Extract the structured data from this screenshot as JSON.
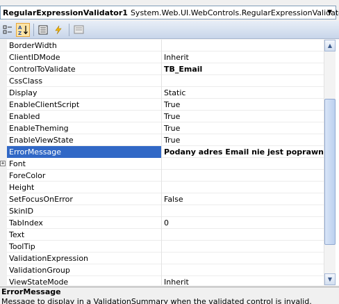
{
  "object_selector": {
    "name": "RegularExpressionValidator1",
    "type": "System.Web.UI.WebControls.RegularExpressionValidator"
  },
  "toolbar": {
    "buttons": [
      {
        "name": "categorized",
        "icon": "categorized-icon"
      },
      {
        "name": "alphabetical",
        "icon": "alphabetical-sort-icon",
        "active": true
      },
      {
        "name": "properties",
        "icon": "properties-icon"
      },
      {
        "name": "events",
        "icon": "lightning-icon"
      },
      {
        "name": "property-pages",
        "icon": "property-pages-icon"
      }
    ]
  },
  "properties": [
    {
      "name": "BorderWidth",
      "value": ""
    },
    {
      "name": "ClientIDMode",
      "value": "Inherit"
    },
    {
      "name": "ControlToValidate",
      "value": "TB_Email"
    },
    {
      "name": "CssClass",
      "value": ""
    },
    {
      "name": "Display",
      "value": "Static"
    },
    {
      "name": "EnableClientScript",
      "value": "True"
    },
    {
      "name": "Enabled",
      "value": "True"
    },
    {
      "name": "EnableTheming",
      "value": "True"
    },
    {
      "name": "EnableViewState",
      "value": "True"
    },
    {
      "name": "ErrorMessage",
      "value": "Podany adres Email nie jest poprawny!!!"
    },
    {
      "name": "Font",
      "value": ""
    },
    {
      "name": "ForeColor",
      "value": ""
    },
    {
      "name": "Height",
      "value": ""
    },
    {
      "name": "SetFocusOnError",
      "value": "False"
    },
    {
      "name": "SkinID",
      "value": ""
    },
    {
      "name": "TabIndex",
      "value": "0"
    },
    {
      "name": "Text",
      "value": ""
    },
    {
      "name": "ToolTip",
      "value": ""
    },
    {
      "name": "ValidationExpression",
      "value": ""
    },
    {
      "name": "ValidationGroup",
      "value": ""
    },
    {
      "name": "ViewStateMode",
      "value": "Inherit"
    }
  ],
  "selected_property": "ErrorMessage",
  "expandable_property": "Font",
  "bold_values": [
    "ControlToValidate",
    "ErrorMessage"
  ],
  "description": {
    "title": "ErrorMessage",
    "text": "Message to display in a ValidationSummary when the validated control is invalid."
  },
  "colors": {
    "selection": "#3168c6",
    "toolbar_active": "#fce4a6"
  }
}
